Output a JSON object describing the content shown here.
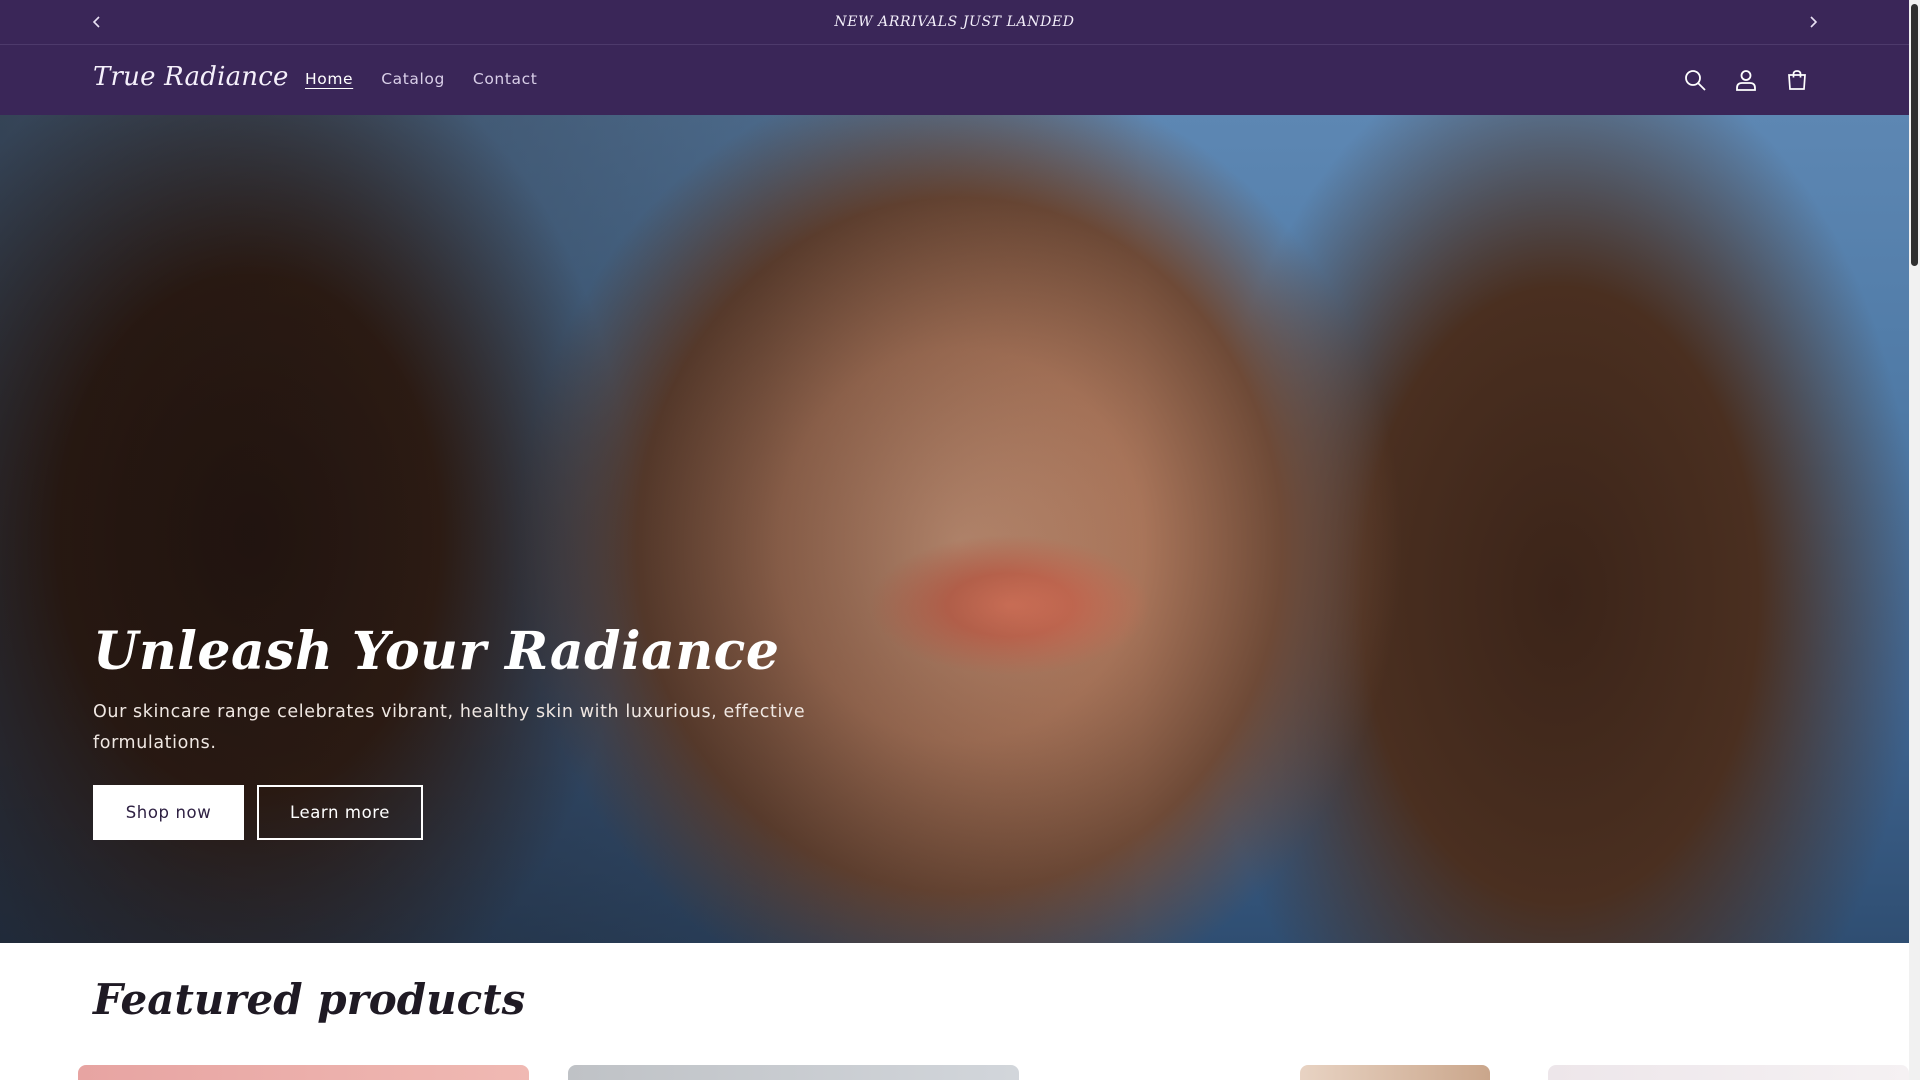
{
  "announcement": {
    "text": "NEW ARRIVALS JUST LANDED",
    "prev_icon": "chevron-left-icon",
    "next_icon": "chevron-right-icon"
  },
  "header": {
    "logo": "True Radiance",
    "nav": [
      {
        "label": "Home",
        "active": true
      },
      {
        "label": "Catalog",
        "active": false
      },
      {
        "label": "Contact",
        "active": false
      }
    ],
    "icons": [
      "search-icon",
      "account-icon",
      "cart-icon"
    ]
  },
  "hero": {
    "title": "Unleash Your Radiance",
    "subtitle": "Our skincare range celebrates vibrant, healthy skin with luxurious, effective formulations.",
    "primary_button": "Shop now",
    "secondary_button": "Learn more"
  },
  "featured": {
    "title": "Featured products"
  },
  "colors": {
    "brand_purple": "#3a2658",
    "text_light": "#ffffff",
    "heading_dark": "#1f1a24"
  }
}
